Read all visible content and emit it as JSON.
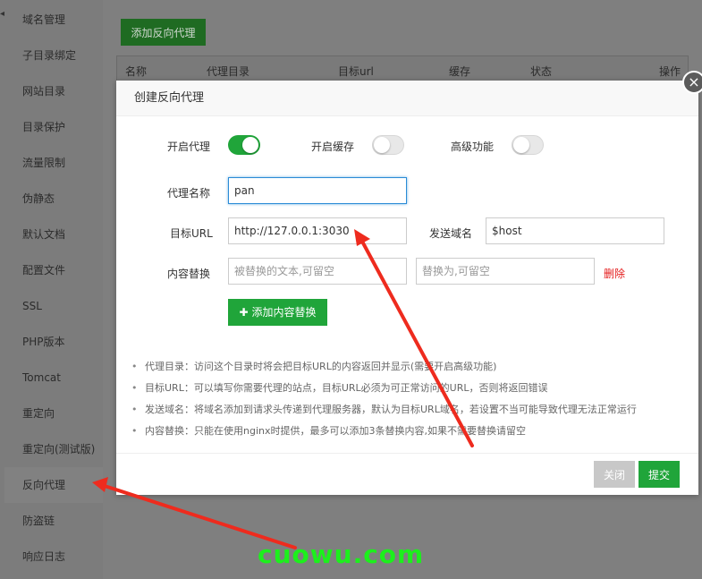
{
  "sidebar": {
    "items": [
      {
        "label": "域名管理"
      },
      {
        "label": "子目录绑定"
      },
      {
        "label": "网站目录"
      },
      {
        "label": "目录保护"
      },
      {
        "label": "流量限制"
      },
      {
        "label": "伪静态"
      },
      {
        "label": "默认文档"
      },
      {
        "label": "配置文件"
      },
      {
        "label": "SSL"
      },
      {
        "label": "PHP版本"
      },
      {
        "label": "Tomcat"
      },
      {
        "label": "重定向"
      },
      {
        "label": "重定向(测试版)"
      },
      {
        "label": "反向代理"
      },
      {
        "label": "防盗链"
      },
      {
        "label": "响应日志"
      }
    ],
    "active_index": 13
  },
  "main": {
    "add_proxy_label": "添加反向代理",
    "columns": [
      "名称",
      "代理目录",
      "目标url",
      "缓存",
      "状态",
      "操作"
    ]
  },
  "dialog": {
    "title": "创建反向代理",
    "toggles": [
      {
        "label": "开启代理",
        "on": true
      },
      {
        "label": "开启缓存",
        "on": false
      },
      {
        "label": "高级功能",
        "on": false
      }
    ],
    "proxy_name_label": "代理名称",
    "proxy_name_value": "pan",
    "target_url_label": "目标URL",
    "target_url_value": "http://127.0.0.1:3030",
    "send_domain_label": "发送域名",
    "send_domain_value": "$host",
    "content_replace_label": "内容替换",
    "replace_from_placeholder": "被替换的文本,可留空",
    "replace_to_placeholder": "替换为,可留空",
    "delete_label": "删除",
    "add_content_label": "添加内容替换",
    "notes": [
      "代理目录：访问这个目录时将会把目标URL的内容返回并显示(需要开启高级功能)",
      "目标URL：可以填写你需要代理的站点，目标URL必须为可正常访问的URL，否则将返回错误",
      "发送域名：将域名添加到请求头传递到代理服务器，默认为目标URL域名，若设置不当可能导致代理无法正常运行",
      "内容替换：只能在使用nginx时提供，最多可以添加3条替换内容,如果不需要替换请留空"
    ],
    "close_label": "关闭",
    "submit_label": "提交",
    "close_icon": "×"
  },
  "colors": {
    "accent": "#20a53a",
    "danger": "#e41b1b",
    "arrow": "#ee2b1e",
    "watermark": "#1cf01c"
  },
  "watermark": "cuowu.com"
}
